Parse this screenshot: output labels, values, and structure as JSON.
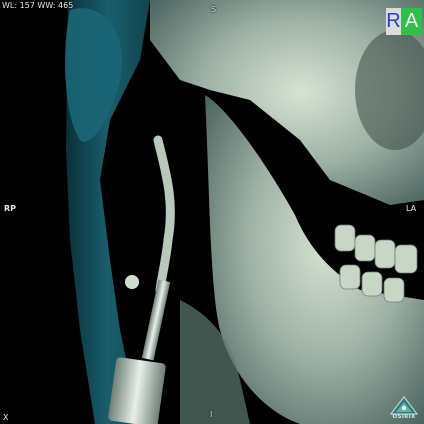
{
  "overlay": {
    "window_level_text": "WL: 157 WW: 465",
    "orientation_top": "S",
    "orientation_left": "RP",
    "orientation_right": "LA",
    "orientation_bottom": "I",
    "corner_bottom_left": "X"
  },
  "orientation_cube": {
    "left_letter": "R",
    "right_letter": "A",
    "left_color": "#2a3fd0",
    "right_bg_color": "#2ec04a"
  },
  "logo": {
    "text": "OSIRIX"
  },
  "colors": {
    "bone": "#b9c9bc",
    "soft_tissue": "#1f6f80",
    "background": "#000000"
  }
}
